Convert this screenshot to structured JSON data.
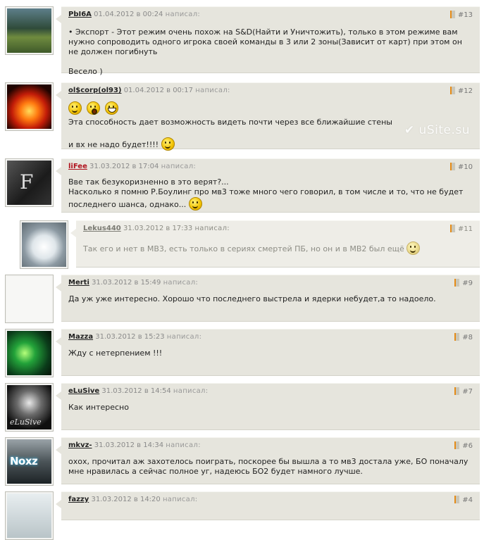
{
  "watermark": "uSite.su",
  "wrote_label": "написал:",
  "comments": [
    {
      "nick": "PbI6A",
      "date": "01.04.2012 в 00:24",
      "number": "#13",
      "lines": [
        "• Экспорт - Этот режим очень похож на S&D(Найти и Уничтожить), только в этом режиме вам нужно сопроводить одного игрока своей команды в 3 или 2 зоны(Зависит от карт) при этом он не должен погибнуть",
        "Весело )"
      ]
    },
    {
      "nick": "ol$corp(ol93)",
      "date": "01.04.2012 в 00:17",
      "number": "#12",
      "smileys": [
        "smile-icon",
        "surprised-icon",
        "grin-icon"
      ],
      "lines": [
        "Эта способность дает возможность видеть почти через все ближайшие стены",
        "и вх не надо будет!!!!"
      ]
    },
    {
      "nick": "liFee",
      "nick_color": "#b0131e",
      "date": "31.03.2012 в 17:04",
      "number": "#10",
      "lines": [
        "Вве так безукоризненно в это верят?...",
        "Насколько я помню Р.Боулинг про мв3 тоже много чего говорил, в том числе и то, что не будет последнего шанса, однако..."
      ]
    },
    {
      "nick": "Lekus440",
      "date": "31.03.2012 в 17:33",
      "number": "#11",
      "reply": true,
      "lines": [
        "Так его и нет в МВ3, есть только в сериях смертей ПБ, но он и в МВ2 был ещё"
      ]
    },
    {
      "nick": "Merti",
      "date": "31.03.2012 в 15:49",
      "number": "#9",
      "lines": [
        "Да уж уже интересно. Хорошо что последнего выстрела и ядерки небудет,а то надоело."
      ]
    },
    {
      "nick": "Mazza",
      "date": "31.03.2012 в 15:23",
      "number": "#8",
      "lines": [
        "Жду с нетерпением !!!"
      ]
    },
    {
      "nick": "eLuSive",
      "date": "31.03.2012 в 14:54",
      "number": "#7",
      "lines": [
        "Как интересно"
      ]
    },
    {
      "nick": "mkvz-",
      "date": "31.03.2012 в 14:34",
      "number": "#6",
      "lines": [
        "охох, прочитал аж захотелось поиграть, поскорее бы вышла а то мв3 достала уже, БО поначалу мне нравилась а сейчас полное уг, надеюсь БО2 будет намного лучше."
      ]
    },
    {
      "nick": "fazzy",
      "date": "31.03.2012 в 14:20",
      "number": "#4",
      "lines": []
    }
  ],
  "avatar_texts": {
    "eLuSive": "eLuSive",
    "mkvz-": "Noxz"
  }
}
